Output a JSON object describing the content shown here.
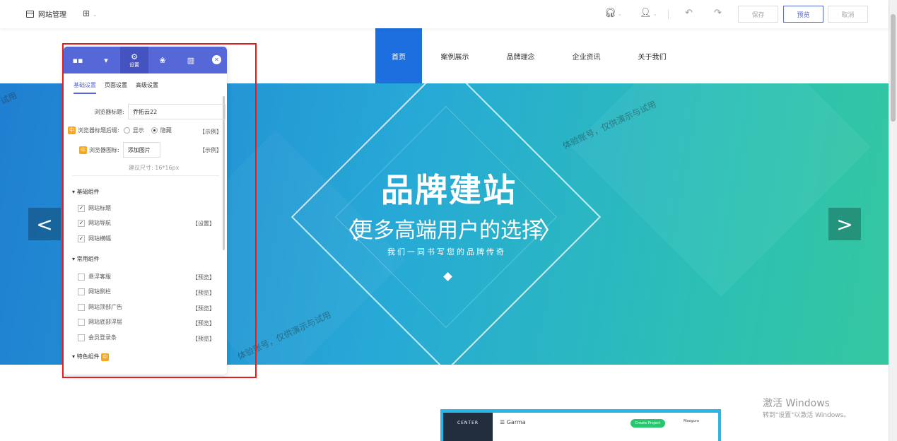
{
  "topbar": {
    "site_manage": "网站管理",
    "grid_icon": "⊞",
    "save": "保存",
    "preview": "预览",
    "cancel": "取消"
  },
  "nav": {
    "items": [
      "首页",
      "案例展示",
      "品牌理念",
      "企业资讯",
      "关于我们"
    ]
  },
  "banner": {
    "title": "品牌建站",
    "subtitle": "更多高端用户的选择",
    "tagline": "我们一同书写您的品牌传奇",
    "watermark1": "试用",
    "watermark2": "体验账号，仅供演示与试用",
    "watermark3": "体验账号，仅供演示与试用"
  },
  "panel": {
    "settings_tab": "设置",
    "subtabs": [
      "基础设置",
      "页面设置",
      "高级设置"
    ],
    "browser_title_label": "浏览器标题:",
    "browser_title_value": "乔拓云22",
    "title_suffix_label": "浏览器标题后缀:",
    "show": "显示",
    "hide": "隐藏",
    "example1": "【示例】",
    "icon_label": "浏览器图标:",
    "add_image": "添加图片",
    "example2": "【示例】",
    "size_hint": "建议尺寸: 16*16px",
    "tag_text": "中",
    "basic_components": "基础组件",
    "basic_items": [
      "网站标题",
      "网站导航",
      "网站横幅"
    ],
    "set_link": "【设置】",
    "common_components": "常用组件",
    "common_items": [
      "悬浮客服",
      "网站侧栏",
      "网站顶部广告",
      "网站底部浮层",
      "会员登录条"
    ],
    "preview_link": "【预览】",
    "special_components": "特色组件"
  },
  "activate": {
    "line1": "激活 Windows",
    "line2": "转到\"设置\"以激活 Windows。"
  },
  "preview_card": {
    "side": "CENTER",
    "brand": "☰ Garma",
    "button": "Create Project",
    "user": "Maegura"
  }
}
